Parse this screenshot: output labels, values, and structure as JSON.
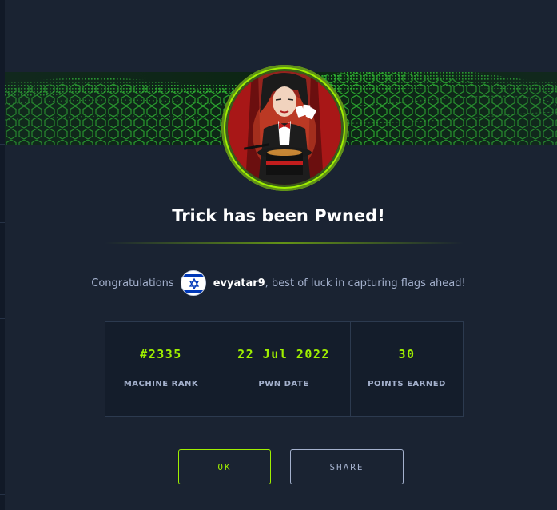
{
  "title": "Trick has been Pwned!",
  "congrats": {
    "prefix": "Congratulations",
    "username": "evyatar9",
    "suffix": ", best of luck in capturing flags ahead!",
    "flag_icon": "israel-flag-icon"
  },
  "stats": [
    {
      "value": "#2335",
      "label": "MACHINE RANK"
    },
    {
      "value": "22 Jul 2022",
      "label": "PWN DATE"
    },
    {
      "value": "30",
      "label": "POINTS EARNED"
    }
  ],
  "buttons": {
    "ok": "OK",
    "share": "SHARE"
  },
  "colors": {
    "accent": "#9fef00",
    "background": "#1a2332",
    "muted_text": "#a4b1cd"
  }
}
